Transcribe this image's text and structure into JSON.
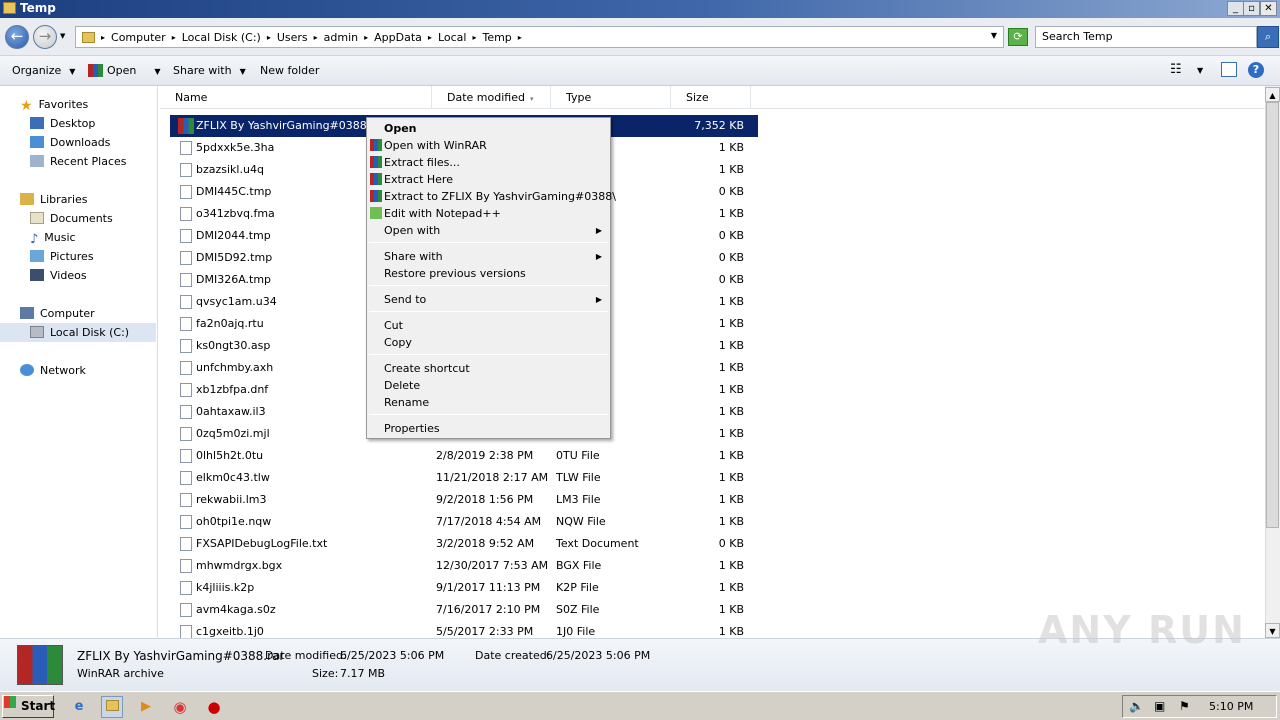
{
  "window": {
    "title": "Temp",
    "buttons": [
      "_",
      "▫",
      "✕"
    ]
  },
  "address": {
    "crumbs": [
      "Computer",
      "Local Disk (C:)",
      "Users",
      "admin",
      "AppData",
      "Local",
      "Temp"
    ],
    "search_placeholder": "Search Temp"
  },
  "toolbar": {
    "organize": "Organize",
    "open": "Open",
    "share_with": "Share with",
    "new_folder": "New folder"
  },
  "nav": {
    "favorites": "Favorites",
    "desktop": "Desktop",
    "downloads": "Downloads",
    "recent_places": "Recent Places",
    "libraries": "Libraries",
    "documents": "Documents",
    "music": "Music",
    "pictures": "Pictures",
    "videos": "Videos",
    "computer": "Computer",
    "local_disk": "Local Disk (C:)",
    "network": "Network"
  },
  "columns": {
    "name": "Name",
    "date": "Date modified",
    "type": "Type",
    "size": "Size"
  },
  "files": [
    {
      "name": "ZFLIX By YashvirGaming#0388.rar",
      "date": "",
      "type": "rchive",
      "size": "7,352 KB"
    },
    {
      "name": "5pdxxk5e.3ha",
      "date": "",
      "type": "",
      "size": "1 KB"
    },
    {
      "name": "bzazsikl.u4q",
      "date": "",
      "type": "",
      "size": "1 KB"
    },
    {
      "name": "DMI445C.tmp",
      "date": "",
      "type": "",
      "size": "0 KB"
    },
    {
      "name": "o341zbvq.fma",
      "date": "",
      "type": "",
      "size": "1 KB"
    },
    {
      "name": "DMI2044.tmp",
      "date": "",
      "type": "",
      "size": "0 KB"
    },
    {
      "name": "DMI5D92.tmp",
      "date": "",
      "type": "",
      "size": "0 KB"
    },
    {
      "name": "DMI326A.tmp",
      "date": "",
      "type": "",
      "size": "0 KB"
    },
    {
      "name": "qvsyc1am.u34",
      "date": "",
      "type": "",
      "size": "1 KB"
    },
    {
      "name": "fa2n0ajq.rtu",
      "date": "",
      "type": "",
      "size": "1 KB"
    },
    {
      "name": "ks0ngt30.asp",
      "date": "",
      "type": "",
      "size": "1 KB"
    },
    {
      "name": "unfchmby.axh",
      "date": "",
      "type": "",
      "size": "1 KB"
    },
    {
      "name": "xb1zbfpa.dnf",
      "date": "",
      "type": "",
      "size": "1 KB"
    },
    {
      "name": "0ahtaxaw.il3",
      "date": "",
      "type": "",
      "size": "1 KB"
    },
    {
      "name": "0zq5m0zi.mjl",
      "date": "",
      "type": "",
      "size": "1 KB"
    },
    {
      "name": "0lhl5h2t.0tu",
      "date": "2/8/2019 2:38 PM",
      "type": "0TU File",
      "size": "1 KB"
    },
    {
      "name": "elkm0c43.tlw",
      "date": "11/21/2018 2:17 AM",
      "type": "TLW File",
      "size": "1 KB"
    },
    {
      "name": "rekwabii.lm3",
      "date": "9/2/2018 1:56 PM",
      "type": "LM3 File",
      "size": "1 KB"
    },
    {
      "name": "oh0tpi1e.nqw",
      "date": "7/17/2018 4:54 AM",
      "type": "NQW File",
      "size": "1 KB"
    },
    {
      "name": "FXSAPIDebugLogFile.txt",
      "date": "3/2/2018 9:52 AM",
      "type": "Text Document",
      "size": "0 KB"
    },
    {
      "name": "mhwmdrgx.bgx",
      "date": "12/30/2017 7:53 AM",
      "type": "BGX File",
      "size": "1 KB"
    },
    {
      "name": "k4jliiis.k2p",
      "date": "9/1/2017 11:13 PM",
      "type": "K2P File",
      "size": "1 KB"
    },
    {
      "name": "avm4kaga.s0z",
      "date": "7/16/2017 2:10 PM",
      "type": "S0Z File",
      "size": "1 KB"
    },
    {
      "name": "c1gxeitb.1j0",
      "date": "5/5/2017 2:33 PM",
      "type": "1J0 File",
      "size": "1 KB"
    }
  ],
  "menu": {
    "open": "Open",
    "open_winrar": "Open with WinRAR",
    "extract_files": "Extract files...",
    "extract_here": "Extract Here",
    "extract_to": "Extract to ZFLIX By YashvirGaming#0388\\",
    "edit_notepad": "Edit with Notepad++",
    "open_with": "Open with",
    "share_with": "Share with",
    "restore": "Restore previous versions",
    "send_to": "Send to",
    "cut": "Cut",
    "copy": "Copy",
    "create_shortcut": "Create shortcut",
    "delete": "Delete",
    "rename": "Rename",
    "properties": "Properties"
  },
  "details": {
    "name": "ZFLIX By YashvirGaming#0388.rar",
    "type": "WinRAR archive",
    "modified_label": "Date modified:",
    "modified": "6/25/2023 5:06 PM",
    "created_label": "Date created:",
    "created": "6/25/2023 5:06 PM",
    "size_label": "Size:",
    "size": "7.17 MB"
  },
  "taskbar": {
    "start": "Start",
    "clock": "5:10 PM"
  },
  "watermark": "ANY RUN"
}
